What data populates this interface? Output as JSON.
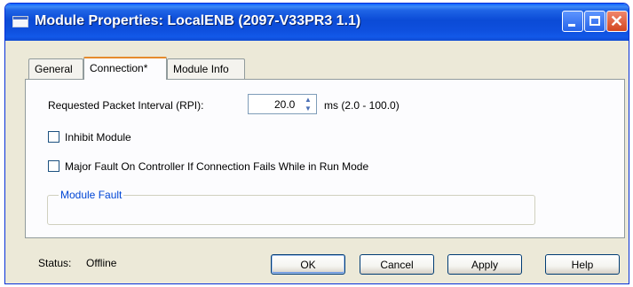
{
  "window": {
    "title": "Module Properties: LocalENB (2097-V33PR3 1.1)"
  },
  "tabs": [
    {
      "label": "General"
    },
    {
      "label": "Connection*"
    },
    {
      "label": "Module Info"
    }
  ],
  "connection": {
    "rpi_label": "Requested Packet Interval (RPI):",
    "rpi_value": "20.0",
    "rpi_range": "ms (2.0 - 100.0)",
    "inhibit_label": "Inhibit Module",
    "inhibit_checked": false,
    "major_fault_label": "Major Fault On Controller If Connection Fails While in Run Mode",
    "major_fault_checked": false,
    "module_fault_label": "Module Fault"
  },
  "status": {
    "label": "Status:",
    "value": "Offline"
  },
  "buttons": {
    "ok": "OK",
    "cancel": "Cancel",
    "apply": "Apply",
    "help": "Help"
  },
  "icons": {
    "window": "window-icon",
    "minimize": "minimize-icon",
    "maximize": "maximize-icon",
    "close": "close-icon",
    "spin_up": "chevron-up-icon",
    "spin_down": "chevron-down-icon"
  },
  "colors": {
    "titlebar": "#0b4bd6",
    "dialog_bg": "#ece9d8",
    "active_tab_accent": "#e68b2c",
    "group_title": "#0046d5"
  }
}
